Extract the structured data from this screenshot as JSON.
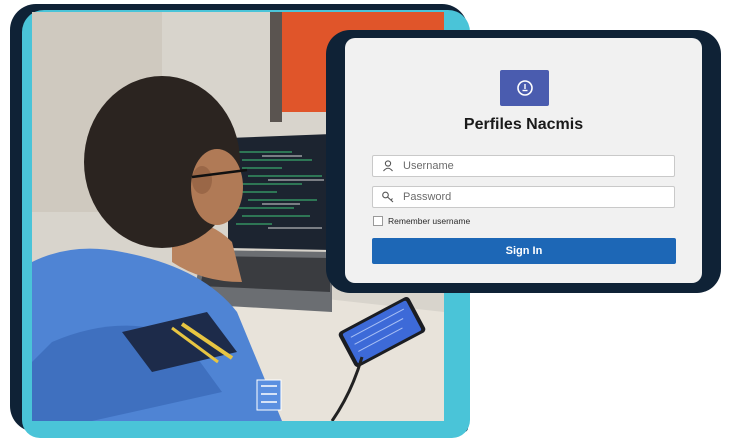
{
  "login": {
    "app_title": "Perfiles Nacmis",
    "username_placeholder": "Username",
    "password_placeholder": "Password",
    "remember_label": "Remember username",
    "signin_label": "Sign In"
  },
  "icons": {
    "logo": "fingerprint-icon",
    "username": "user-icon",
    "password": "key-icon"
  },
  "colors": {
    "frame_dark": "#0f2236",
    "frame_cyan": "#4ac4d8",
    "logo_bg": "#4a5caf",
    "button_bg": "#1d67b6",
    "card_bg": "#f1f1f1"
  }
}
